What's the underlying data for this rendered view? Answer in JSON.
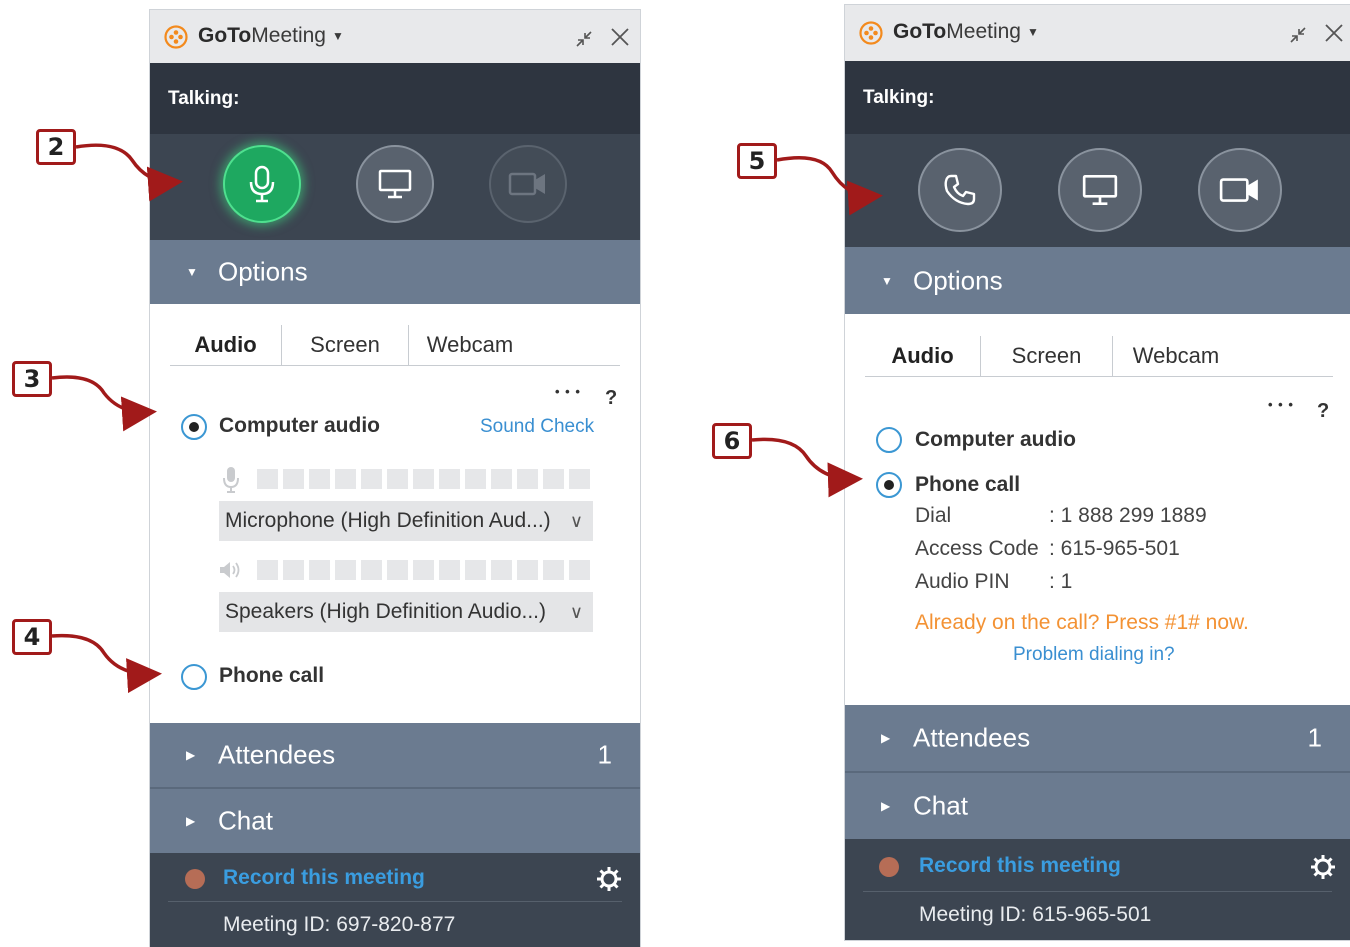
{
  "app": {
    "brand_bold": "GoTo",
    "brand_rest": "Meeting"
  },
  "left": {
    "talking_label": "Talking:",
    "options_label": "Options",
    "tabs": [
      "Audio",
      "Screen",
      "Webcam"
    ],
    "more": "• • •",
    "help": "?",
    "computer_audio": "Computer audio",
    "sound_check": "Sound Check",
    "microphone": "Microphone (High Definition Aud...)",
    "speakers": "Speakers (High Definition Audio...)",
    "phone_call": "Phone call",
    "attendees_label": "Attendees",
    "attendees_count": "1",
    "chat_label": "Chat",
    "record_label": "Record this meeting",
    "meeting_id": "Meeting ID: 697-820-877",
    "selected": "computer_audio",
    "mic_active": true,
    "webcam_active": false
  },
  "right": {
    "talking_label": "Talking:",
    "options_label": "Options",
    "tabs": [
      "Audio",
      "Screen",
      "Webcam"
    ],
    "more": "• • •",
    "help": "?",
    "computer_audio": "Computer audio",
    "phone_call": "Phone call",
    "dial_label": "Dial",
    "dial_value": ": 1 888 299 1889",
    "access_label": "Access Code",
    "access_value": ": 615-965-501",
    "pin_label": "Audio PIN",
    "pin_value": ": 1",
    "already": "Already on the call? Press #1# now.",
    "problem": "Problem dialing in?",
    "attendees_label": "Attendees",
    "attendees_count": "1",
    "chat_label": "Chat",
    "record_label": "Record this meeting",
    "meeting_id": "Meeting ID: 615-965-501",
    "selected": "phone_call"
  },
  "badges": [
    "2",
    "3",
    "4",
    "5",
    "6"
  ],
  "colors": {
    "accent_blue": "#3a8fd1",
    "green_mic": "#1ea860",
    "badge_border": "#a11a1a",
    "warning_orange": "#f39234"
  },
  "icons": [
    "gotomeeting-logo-icon",
    "minimize-icon",
    "close-icon",
    "microphone-icon",
    "screen-icon",
    "webcam-icon",
    "phone-icon",
    "speaker-icon",
    "settings-gear-icon"
  ]
}
